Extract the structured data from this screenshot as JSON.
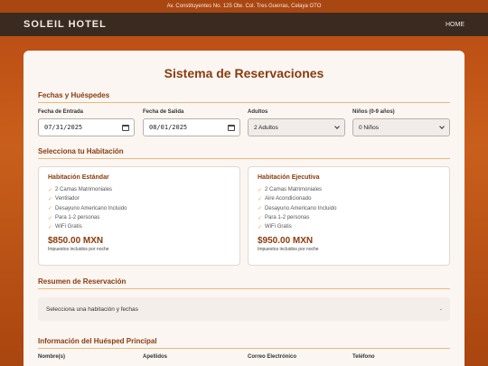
{
  "topbar": {
    "address": "Av. Constituyentes No. 125 Ote. Col. Tres Guerras, Celaya GTO"
  },
  "navbar": {
    "brand": "SOLEIL HOTEL",
    "home": "HOME"
  },
  "page": {
    "title": "Sistema de Reservaciones"
  },
  "dates": {
    "section_title": "Fechas y Huéspedes",
    "checkin_label": "Fecha de Entrada",
    "checkin_value": "07/31/2025",
    "checkout_label": "Fecha de Salida",
    "checkout_value": "08/01/2025",
    "adults_label": "Adultos",
    "adults_value": "2 Adultos",
    "children_label": "Niños (0-9 años)",
    "children_value": "0 Niños"
  },
  "rooms": {
    "section_title": "Selecciona tu Habitación",
    "items": [
      {
        "name": "Habitación Estándar",
        "amenities": [
          "2 Camas Matrimoniales",
          "Ventilador",
          "Desayuno Americano Incluido",
          "Para 1-2 personas",
          "WiFi Gratis"
        ],
        "price": "$850.00 MXN",
        "price_note": "Impuestos incluidos por noche"
      },
      {
        "name": "Habitación Ejecutiva",
        "amenities": [
          "2 Camas Matrimoniales",
          "Aire Acondicionado",
          "Desayuno Americano Incluido",
          "Para 1-2 personas",
          "WiFi Gratis"
        ],
        "price": "$950.00 MXN",
        "price_note": "Impuestos incluidos por noche"
      }
    ]
  },
  "summary": {
    "section_title": "Resumen de Reservación",
    "text": "Selecciona una habitación y fechas",
    "value": "-"
  },
  "guest": {
    "section_title": "Información del Huésped Principal",
    "name_label": "Nombre(s)",
    "lastname_label": "Apellidos",
    "email_label": "Correo Electrónico",
    "phone_label": "Teléfono"
  }
}
